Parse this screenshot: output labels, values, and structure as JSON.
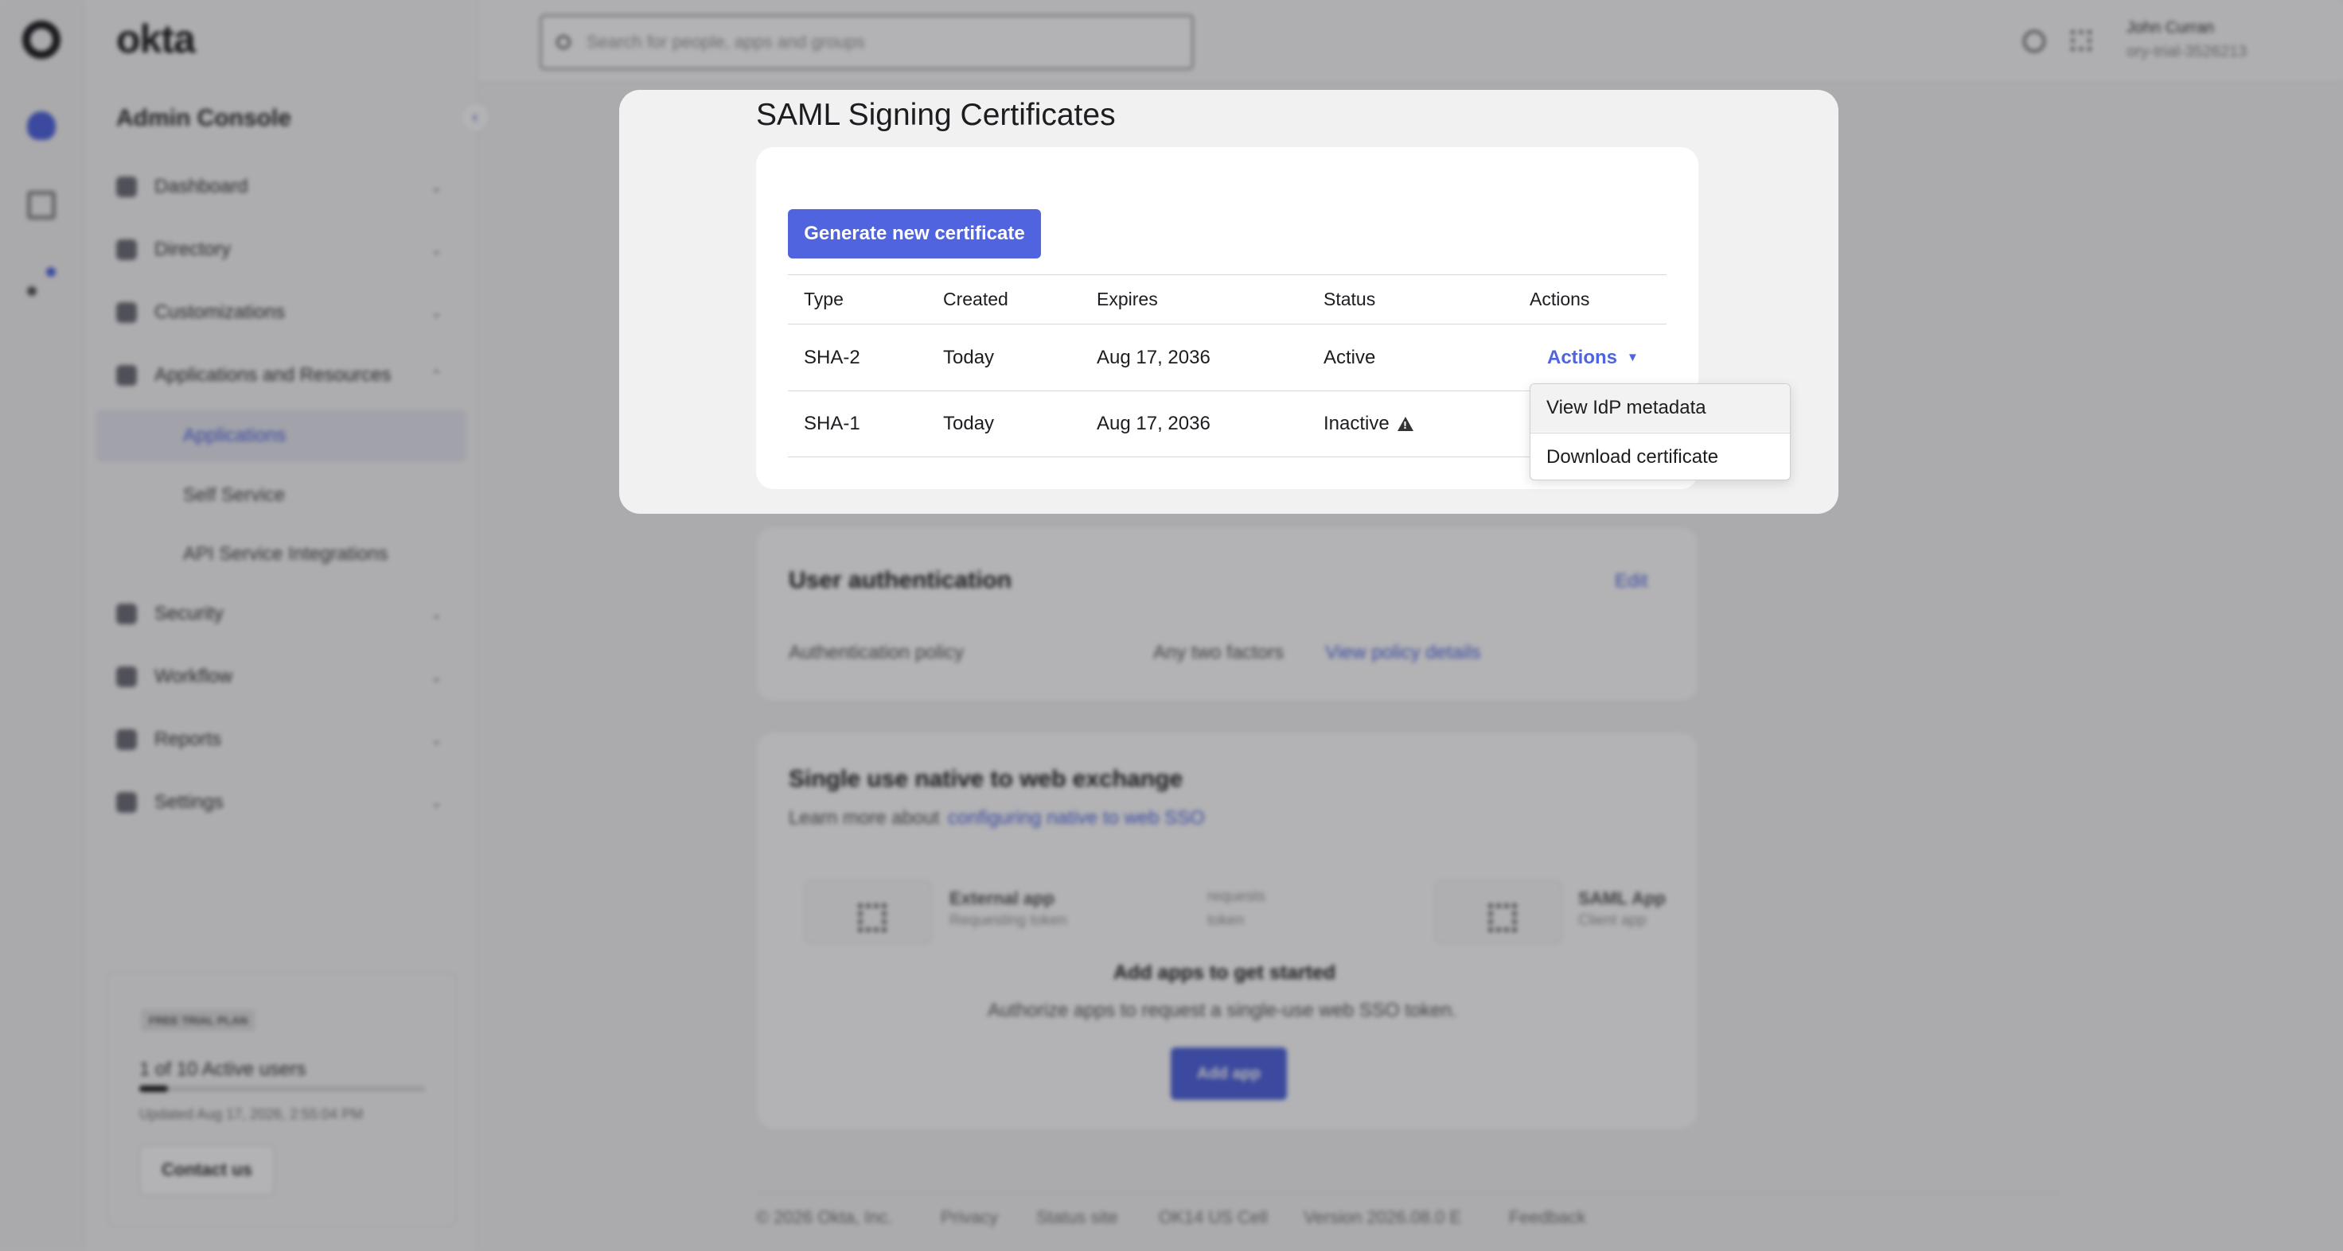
{
  "app": {
    "brand": "okta",
    "console_title": "Admin Console",
    "search_placeholder": "Search for people, apps and groups",
    "user_name": "John Curran",
    "org": "ory-trial-3526213"
  },
  "sidebar": {
    "items": [
      {
        "label": "Dashboard"
      },
      {
        "label": "Directory"
      },
      {
        "label": "Customizations"
      },
      {
        "label": "Applications and Resources"
      },
      {
        "label": "Security"
      },
      {
        "label": "Workflow"
      },
      {
        "label": "Reports"
      },
      {
        "label": "Settings"
      }
    ],
    "subitems": [
      {
        "label": "Applications"
      },
      {
        "label": "Self Service"
      },
      {
        "label": "API Service Integrations"
      }
    ],
    "trial": {
      "plan": "FREE TRIAL PLAN",
      "users": "1 of 10 Active users",
      "users_fraction": 0.1,
      "updated": "Updated Aug 17, 2026, 2:55:04 PM",
      "contact": "Contact us"
    }
  },
  "background": {
    "auth": {
      "title": "User authentication",
      "edit": "Edit",
      "policy_label": "Authentication policy",
      "policy_value": "Any two factors",
      "policy_link": "View policy details"
    },
    "native": {
      "title": "Single use native to web exchange",
      "learn_prefix": "Learn more about",
      "learn_link": "configuring native to web SSO",
      "ext_app": "External app",
      "ext_sub": "Requesting token",
      "requests": "requests",
      "token": "token",
      "saml_app": "SAML App",
      "saml_sub": "Client app",
      "empty_title": "Add apps to get started",
      "empty_desc": "Authorize apps to request a single-use web SSO token.",
      "add_btn": "Add app"
    },
    "footer": [
      "© 2026 Okta, Inc.",
      "Privacy",
      "Status site",
      "OK14 US Cell",
      "Version 2026.08.0 E",
      "Feedback"
    ]
  },
  "modal": {
    "title": "SAML Signing Certificates",
    "generate_label": "Generate new certificate",
    "columns": [
      "Type",
      "Created",
      "Expires",
      "Status",
      "Actions"
    ],
    "rows": [
      {
        "type": "SHA-2",
        "created": "Today",
        "expires": "Aug 17, 2036",
        "status": "Active",
        "actions": "Actions"
      },
      {
        "type": "SHA-1",
        "created": "Today",
        "expires": "Aug 17, 2036",
        "status": "Inactive"
      }
    ],
    "menu": [
      "View IdP metadata",
      "Download certificate"
    ]
  },
  "colors": {
    "accent": "#4f64de",
    "text": "#1d1d21"
  }
}
